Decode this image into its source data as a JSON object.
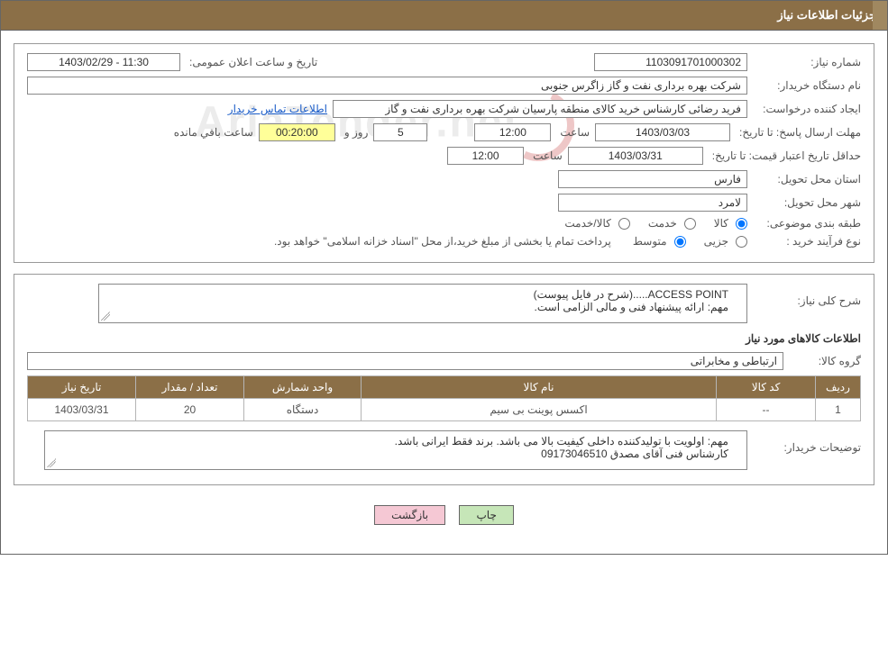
{
  "header": {
    "title": "جزئیات اطلاعات نیاز"
  },
  "need_number": {
    "label": "شماره نیاز:",
    "value": "1103091701000302"
  },
  "announce": {
    "label": "تاریخ و ساعت اعلان عمومی:",
    "value": "1403/02/29 - 11:30"
  },
  "buyer_device": {
    "label": "نام دستگاه خریدار:",
    "value": "شرکت بهره برداری نفت و گاز زاگرس جنوبی"
  },
  "requester": {
    "label": "ایجاد کننده درخواست:",
    "value": "فرید رضائی کارشناس خرید کالای منطقه پارسیان شرکت بهره برداری نفت و گاز",
    "contact_link": "اطلاعات تماس خریدار"
  },
  "deadline": {
    "label": "مهلت ارسال پاسخ:",
    "to_label": "تا تاریخ:",
    "date": "1403/03/03",
    "time_label": "ساعت",
    "time": "12:00",
    "days": "5",
    "days_label": "روز و",
    "remaining": "00:20:00",
    "remaining_label": "ساعت باقي مانده"
  },
  "price_validity": {
    "label": "حداقل تاریخ اعتبار قیمت:",
    "to_label": "تا تاریخ:",
    "date": "1403/03/31",
    "time_label": "ساعت",
    "time": "12:00"
  },
  "province": {
    "label": "استان محل تحویل:",
    "value": "فارس"
  },
  "city": {
    "label": "شهر محل تحویل:",
    "value": "لامرد"
  },
  "classification": {
    "label": "طبقه بندی موضوعی:",
    "opts": [
      "کالا",
      "خدمت",
      "کالا/خدمت"
    ]
  },
  "purchase_type": {
    "label": "نوع فرآیند خرید :",
    "opts": [
      "جزیی",
      "متوسط"
    ],
    "note": "پرداخت تمام یا بخشی از مبلغ خرید،از محل \"اسناد خزانه اسلامی\" خواهد بود."
  },
  "general_desc": {
    "label": "شرح کلی نیاز:",
    "value": "ACCESS POINT.....(شرح در فایل پیوست)\nمهم: ارائه پیشنهاد فنی و مالی الزامی است."
  },
  "items_section": "اطلاعات کالاهای مورد نیاز",
  "goods_group": {
    "label": "گروه کالا:",
    "value": "ارتباطی و مخابراتی"
  },
  "table": {
    "headers": [
      "ردیف",
      "کد کالا",
      "نام کالا",
      "واحد شمارش",
      "تعداد / مقدار",
      "تاریخ نیاز"
    ],
    "rows": [
      {
        "idx": "1",
        "code": "--",
        "name": "اکسس پوینت بی سیم",
        "unit": "دستگاه",
        "qty": "20",
        "date": "1403/03/31"
      }
    ]
  },
  "buyer_notes": {
    "label": "توضیحات خریدار:",
    "value": "مهم: اولویت با تولیدکننده داخلی کیفیت بالا می باشد. برند فقط ایرانی باشد.\nکارشناس فنی آقای مصدق 09173046510"
  },
  "buttons": {
    "print": "چاپ",
    "back": "بازگشت"
  },
  "watermark": "AriaTender.net"
}
